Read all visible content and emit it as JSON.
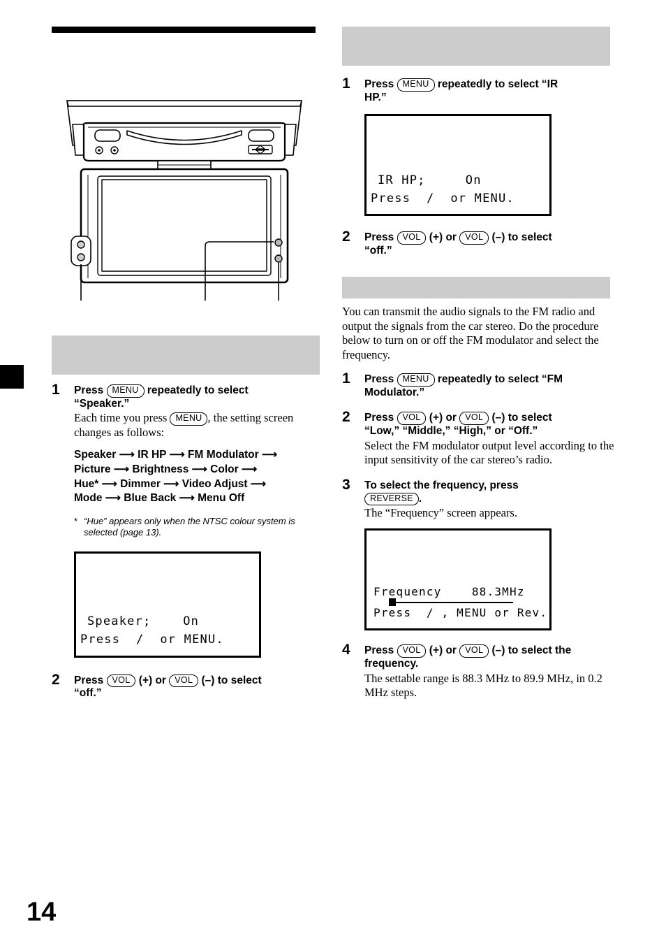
{
  "page": {
    "number": "14"
  },
  "illustration": {
    "name": "flip-down-monitor-front-view",
    "callout_count": 3
  },
  "left_column": {
    "section_header": "",
    "steps": [
      {
        "num": "1",
        "head_prefix": "Press",
        "button": "MENU",
        "head_suffix": "repeatedly to select",
        "head_line2": "“Speaker.”",
        "body_prefix": "Each time you press",
        "body_button": "MENU",
        "body_suffix": ", the setting screen changes as follows:"
      },
      {
        "num": "2",
        "head_prefix": "Press",
        "button1": "VOL",
        "mid1": "(+) or",
        "button2": "VOL",
        "mid2": "(–) to select",
        "head_line2": "“off.”"
      }
    ],
    "flow": [
      "Speaker",
      "IR HP",
      "FM Modulator",
      "Picture",
      "Brightness",
      "Color",
      "Hue*",
      "Dimmer",
      "Video Adjust",
      "Mode",
      "Blue Back",
      "Menu Off"
    ],
    "flow_lines": [
      "Speaker ⟶ IR HP ⟶ FM Modulator ⟶",
      "Picture ⟶ Brightness ⟶ Color ⟶",
      "Hue* ⟶ Dimmer ⟶ Video Adjust ⟶",
      "Mode ⟶ Blue Back ⟶ Menu Off"
    ],
    "footnote": {
      "marker": "*",
      "text": "“Hue” appears only when the NTSC colour system is selected (page 13)."
    },
    "lcd": {
      "line1": "Speaker;    On",
      "line2": "Press  /  or MENU."
    }
  },
  "right_column": {
    "section_header_1": "",
    "section_header_2": "",
    "ir_hp": {
      "steps": [
        {
          "num": "1",
          "head_prefix": "Press",
          "button": "MENU",
          "head_suffix": "repeatedly to select “IR",
          "head_line2": "HP.”"
        },
        {
          "num": "2",
          "head_prefix": "Press",
          "button1": "VOL",
          "mid1": "(+) or",
          "button2": "VOL",
          "mid2": "(–) to select",
          "head_line2": "“off.”"
        }
      ],
      "lcd": {
        "line1": "IR HP;     On",
        "line2": "Press  /  or MENU."
      }
    },
    "fm_modulator": {
      "intro": "You can transmit the audio signals to the FM radio and output the signals from the car stereo. Do the procedure below to turn on or off the FM modulator and select the frequency.",
      "steps": [
        {
          "num": "1",
          "head_prefix": "Press",
          "button": "MENU",
          "head_suffix": "repeatedly to select “FM",
          "head_line2": "Modulator.”"
        },
        {
          "num": "2",
          "head_prefix": "Press",
          "button1": "VOL",
          "mid1": "(+) or",
          "button2": "VOL",
          "mid2": "(–) to select",
          "head_line2": "“Low,” “Middle,” “High,” or “Off.”",
          "body": "Select the FM modulator output level according to the input sensitivity of the car stereo’s radio."
        },
        {
          "num": "3",
          "head_prefix": "To select the frequency, press",
          "button": "REVERSE",
          "head_suffix": ".",
          "body": "The “Frequency” screen appears."
        },
        {
          "num": "4",
          "head_prefix": "Press",
          "button1": "VOL",
          "mid1": "(+) or",
          "button2": "VOL",
          "mid2": "(–) to select the",
          "head_line2": "frequency.",
          "body": "The settable range is 88.3 MHz to 89.9 MHz, in 0.2 MHz steps."
        }
      ],
      "lcd": {
        "line1": "Frequency    88.3MHz",
        "line2": "Press  / , MENU or Rev.",
        "slider_value": "88.3MHz"
      }
    }
  },
  "colors": {
    "section_bar": "#cccccc",
    "rule": "#000000",
    "text": "#000000",
    "page_bg": "#ffffff"
  }
}
